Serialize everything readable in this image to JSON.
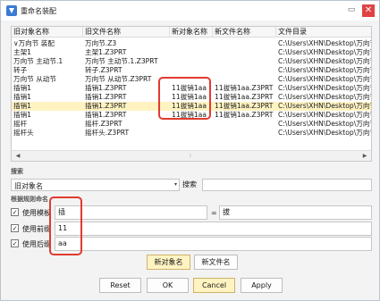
{
  "window": {
    "title": "重命名装配"
  },
  "grid": {
    "columns": [
      "旧对象名称",
      "旧文件名称",
      "新对象名称",
      "新文件名称",
      "文件目录"
    ],
    "rows": [
      [
        "∨万向节 装配",
        "万向节.Z3",
        "",
        "",
        "C:\\Users\\XHN\\Desktop\\万向节"
      ],
      [
        "主架1",
        "主架1.Z3PRT",
        "",
        "",
        "C:\\Users\\XHN\\Desktop\\万向节"
      ],
      [
        "万向节 主动节.1",
        "万向节 主动节.1.Z3PRT",
        "",
        "",
        "C:\\Users\\XHN\\Desktop\\万向节"
      ],
      [
        "转子",
        "转子.Z3PRT",
        "",
        "",
        "C:\\Users\\XHN\\Desktop\\万向节"
      ],
      [
        "万向节 从动节",
        "万向节 从动节.Z3PRT",
        "",
        "",
        "C:\\Users\\XHN\\Desktop\\万向节"
      ],
      [
        "插销1",
        "插销1.Z3PRT",
        "11拔销1aa",
        "11拔销1aa.Z3PRT",
        "C:\\Users\\XHN\\Desktop\\万向节"
      ],
      [
        "插销1",
        "插销1.Z3PRT",
        "11拔销1aa",
        "11拔销1aa.Z3PRT",
        "C:\\Users\\XHN\\Desktop\\万向节"
      ],
      [
        "插销1",
        "插销1.Z3PRT",
        "11拔销1aa",
        "11拔销1aa.Z3PRT",
        "C:\\Users\\XHN\\Desktop\\万向节"
      ],
      [
        "插销1",
        "插销1.Z3PRT",
        "11拔销1aa",
        "11拔销1aa.Z3PRT",
        "C:\\Users\\XHN\\Desktop\\万向节"
      ],
      [
        "摇杆",
        "摇杆.Z3PRT",
        "",
        "",
        "C:\\Users\\XHN\\Desktop\\万向节"
      ],
      [
        "摇杆头",
        "摇杆头.Z3PRT",
        "",
        "",
        "C:\\Users\\XHN\\Desktop\\万向节"
      ]
    ],
    "selected_row_index": 7
  },
  "search": {
    "section_label": "搜索",
    "combo_value": "旧对象名",
    "button_label": "搜索",
    "field_value": ""
  },
  "rules": {
    "section_label": "根据规则命名",
    "replace": {
      "label": "使用模板",
      "from": "插",
      "to": "拔",
      "checked": true
    },
    "prefix": {
      "label": "使用前缀",
      "value": "11",
      "checked": true
    },
    "suffix": {
      "label": "使用后缀",
      "value": "aa",
      "checked": true
    }
  },
  "rename_buttons": {
    "new_object": "新对象名",
    "new_file": "新文件名"
  },
  "footer": {
    "reset": "Reset",
    "ok": "OK",
    "cancel": "Cancel",
    "apply": "Apply"
  },
  "colors": {
    "highlight": "#fff3c2",
    "annotation": "#e03b2f",
    "close": "#e04343"
  },
  "icons": {
    "app": "app-icon",
    "scroll_left": "◀",
    "scroll_right": "▶",
    "checkbox_mark": "✓"
  }
}
